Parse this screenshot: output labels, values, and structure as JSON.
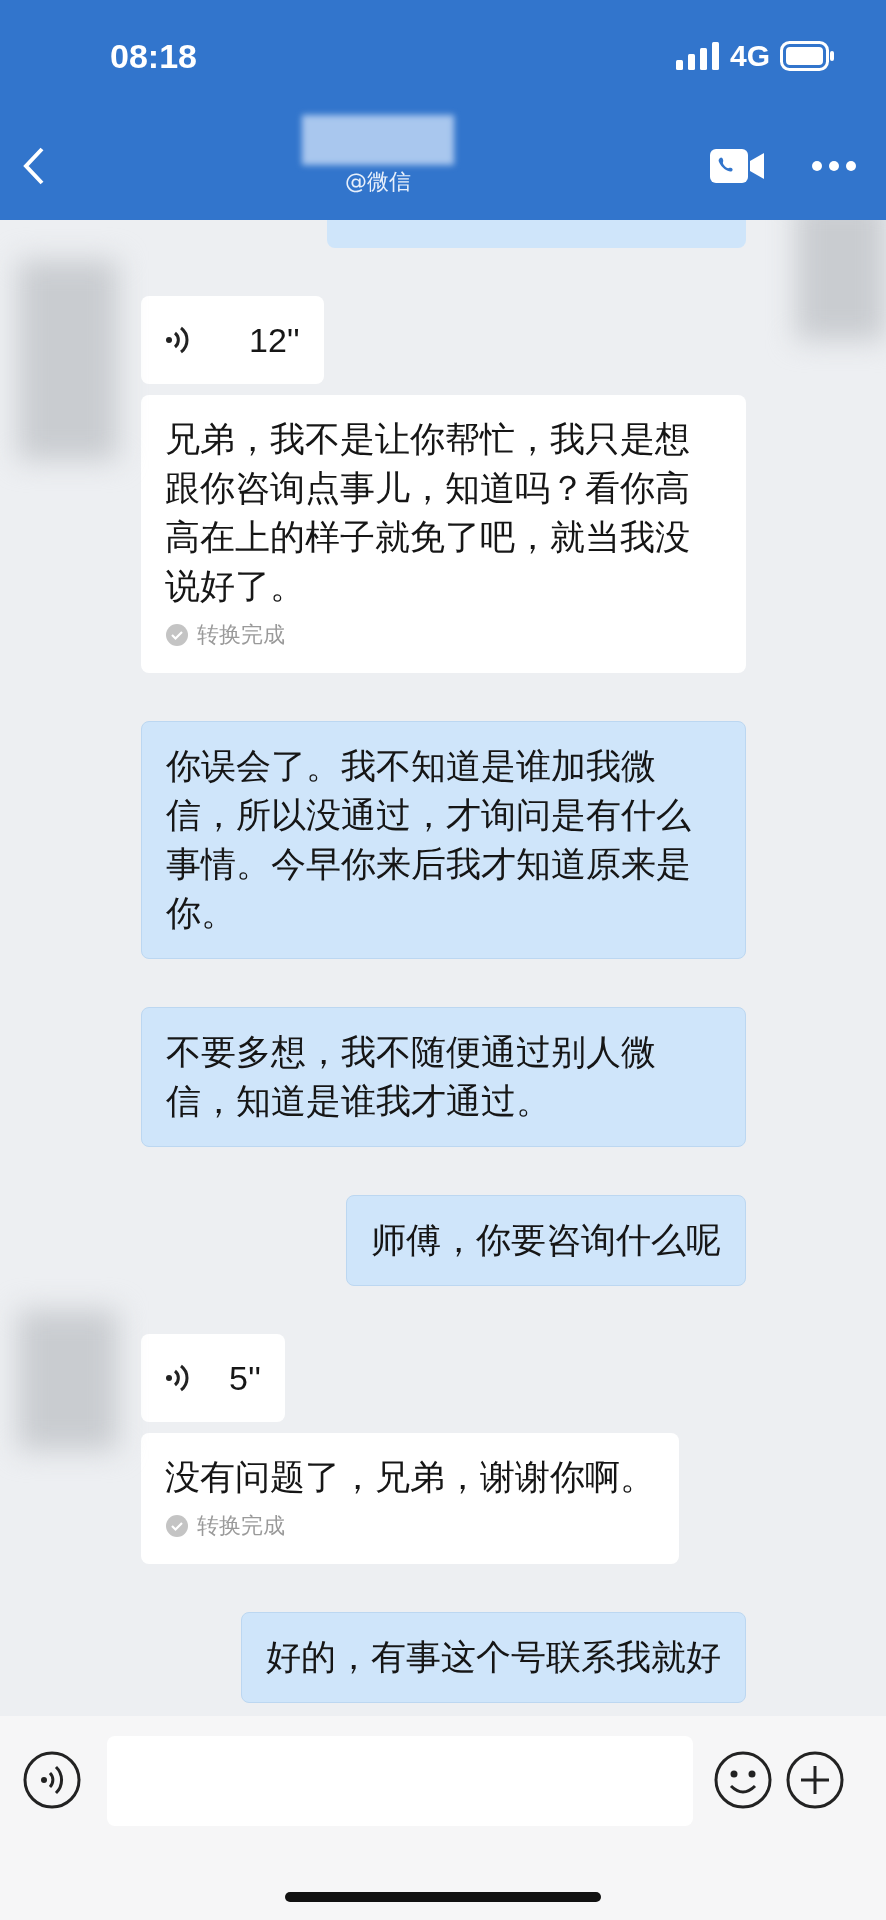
{
  "status_bar": {
    "time": "08:18",
    "network": "4G"
  },
  "header": {
    "subtitle": "@微信"
  },
  "messages": [
    {
      "outgoing": false,
      "kind": "voice",
      "duration": "12''"
    },
    {
      "outgoing": false,
      "kind": "transcript",
      "text": "兄弟，我不是让你帮忙，我只是想跟你咨询点事儿，知道吗？看你高高在上的样子就免了吧，就当我没说好了。",
      "status": "转换完成"
    },
    {
      "outgoing": true,
      "kind": "text",
      "text": "你误会了。我不知道是谁加我微信，所以没通过，才询问是有什么事情。今早你来后我才知道原来是你。"
    },
    {
      "outgoing": true,
      "kind": "text",
      "text": "不要多想，我不随便通过别人微信，知道是谁我才通过。"
    },
    {
      "outgoing": true,
      "kind": "text",
      "text": "师傅，你要咨询什么呢"
    },
    {
      "outgoing": false,
      "kind": "voice",
      "duration": "5''"
    },
    {
      "outgoing": false,
      "kind": "transcript",
      "text": "没有问题了，兄弟，谢谢你啊。",
      "status": "转换完成"
    },
    {
      "outgoing": true,
      "kind": "text",
      "text": "好的，有事这个号联系我就好"
    }
  ]
}
